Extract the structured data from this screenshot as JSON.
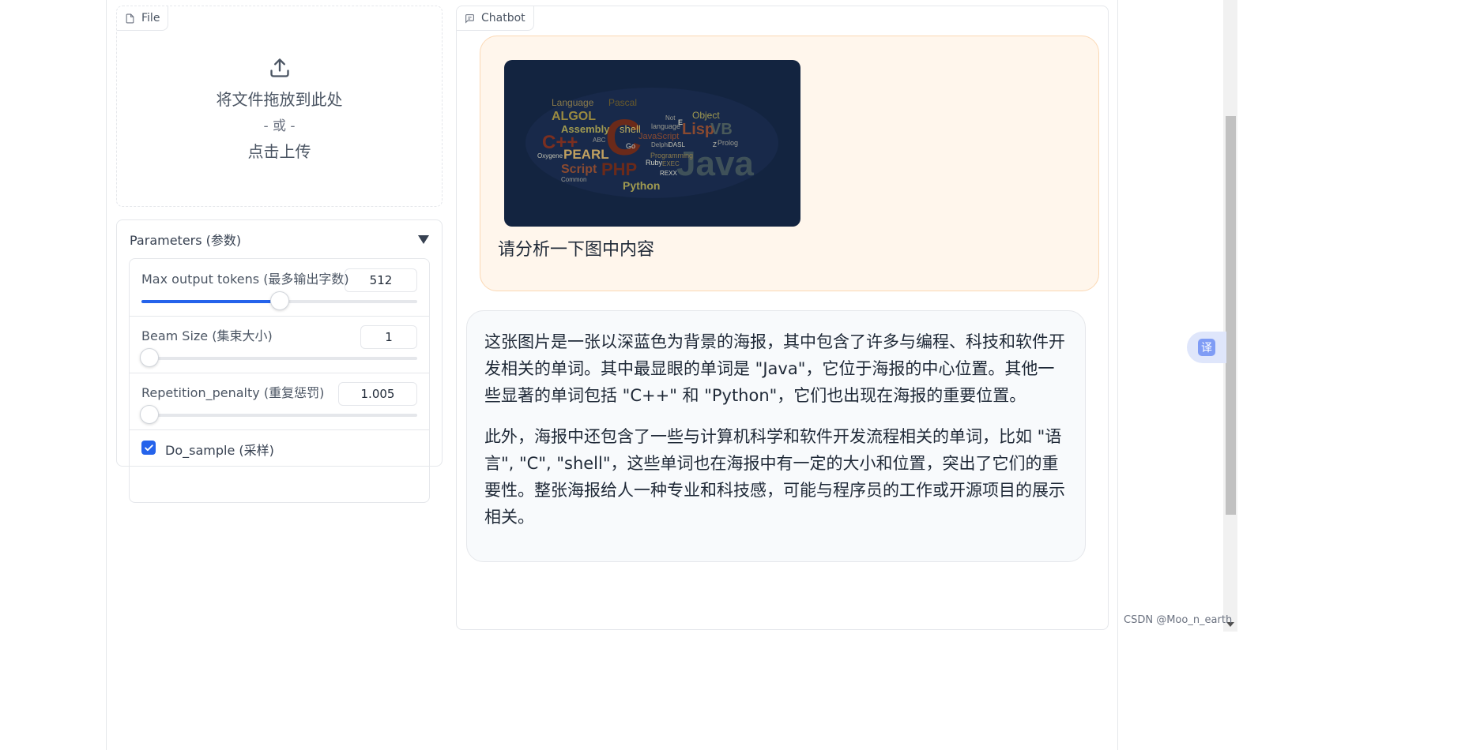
{
  "file_block": {
    "label": "File",
    "drop_text": "将文件拖放到此处",
    "or_text": "- 或 -",
    "click_text": "点击上传"
  },
  "params": {
    "title": "Parameters (参数)",
    "max_tokens": {
      "label": "Max output tokens (最多输出字数)",
      "value": "512",
      "slider_fraction": 0.5
    },
    "beam_size": {
      "label": "Beam Size (集束大小)",
      "value": "1",
      "slider_fraction": 0.0
    },
    "repetition": {
      "label": "Repetition_penalty (重复惩罚)",
      "value": "1.005",
      "slider_fraction": 0.03
    },
    "do_sample": {
      "label": "Do_sample (采样)",
      "checked": true
    }
  },
  "chatbot": {
    "label": "Chatbot",
    "user_message": "请分析一下图中内容",
    "user_image_words": [
      "Language",
      "Pascal",
      "ALGOL",
      "Assembly",
      "C++",
      "C",
      "shell",
      "Lisp",
      "VB",
      "Object",
      "JavaScript",
      "language",
      "Not",
      "E",
      "Java",
      "PEARL",
      "Go",
      "Delphi",
      "DASL",
      "Prolog",
      "Oxygene",
      "Script",
      "PHP",
      "Programming",
      "Ruby",
      "EXEC",
      "REXX",
      "Common",
      "Python",
      "ABC",
      "Z"
    ],
    "bot_paragraphs": [
      "这张图片是一张以深蓝色为背景的海报，其中包含了许多与编程、科技和软件开发相关的单词。其中最显眼的单词是 \"Java\"，它位于海报的中心位置。其他一些显著的单词包括 \"C++\" 和 \"Python\"，它们也出现在海报的重要位置。",
      "此外，海报中还包含了一些与计算机科学和软件开发流程相关的单词，比如 \"语言\", \"C\", \"shell\"，这些单词也在海报中有一定的大小和位置，突出了它们的重要性。整张海报给人一种专业和科技感，可能与程序员的工作或开源项目的展示相关。"
    ]
  },
  "translate_button": "译",
  "watermark": "CSDN @Moo_n_earth",
  "colors": {
    "accent": "#2563eb",
    "user_bubble": "#fff6ec",
    "bot_bubble": "#f8fafc",
    "poster_bg": "#132440"
  }
}
